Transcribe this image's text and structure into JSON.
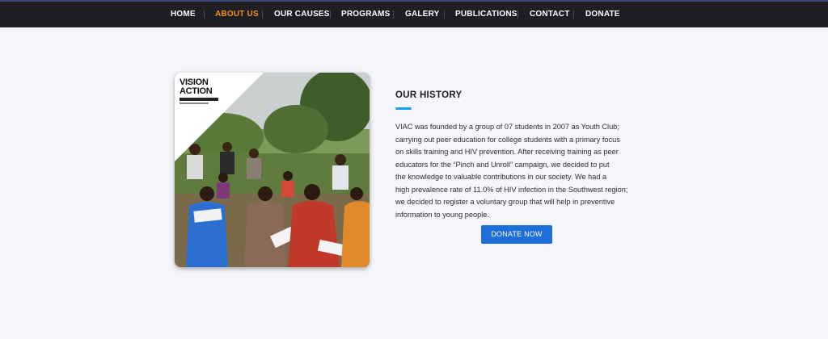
{
  "nav": {
    "items": [
      {
        "label": "HOME",
        "active": false
      },
      {
        "label": "ABOUT US",
        "active": true
      },
      {
        "label": "OUR CAUSES",
        "active": false
      },
      {
        "label": "PROGRAMS",
        "active": false
      },
      {
        "label": "GALERY",
        "active": false
      },
      {
        "label": "PUBLICATIONS",
        "active": false
      },
      {
        "label": "CONTACT",
        "active": false
      },
      {
        "label": "DONATE",
        "active": false
      }
    ],
    "active_color": "#f0901a"
  },
  "photo": {
    "logo_line1": "VISION",
    "logo_line2": "ACTION"
  },
  "history": {
    "title": "OUR HISTORY",
    "lines": [
      "VIAC was founded by a group of 07 students in 2007 as Youth Club;",
      "carrying out peer education for college students with a primary focus",
      "on skills training and HIV prevention. After receiving training as peer",
      "educators for the “Pinch and Unroll” campaign, we decided to put",
      "the knowledge to valuable contributions in our society. We had a",
      "high prevalence rate of 11.0% of HIV infection in the Southwest region;",
      "we decided to register a voluntary group that will help in preventive",
      "information to young people."
    ],
    "donate_label": "DONATE NOW"
  },
  "colors": {
    "nav_bg": "#1e1f22",
    "accent_blue": "#1aa0e6",
    "button_blue": "#1f6fd8"
  }
}
